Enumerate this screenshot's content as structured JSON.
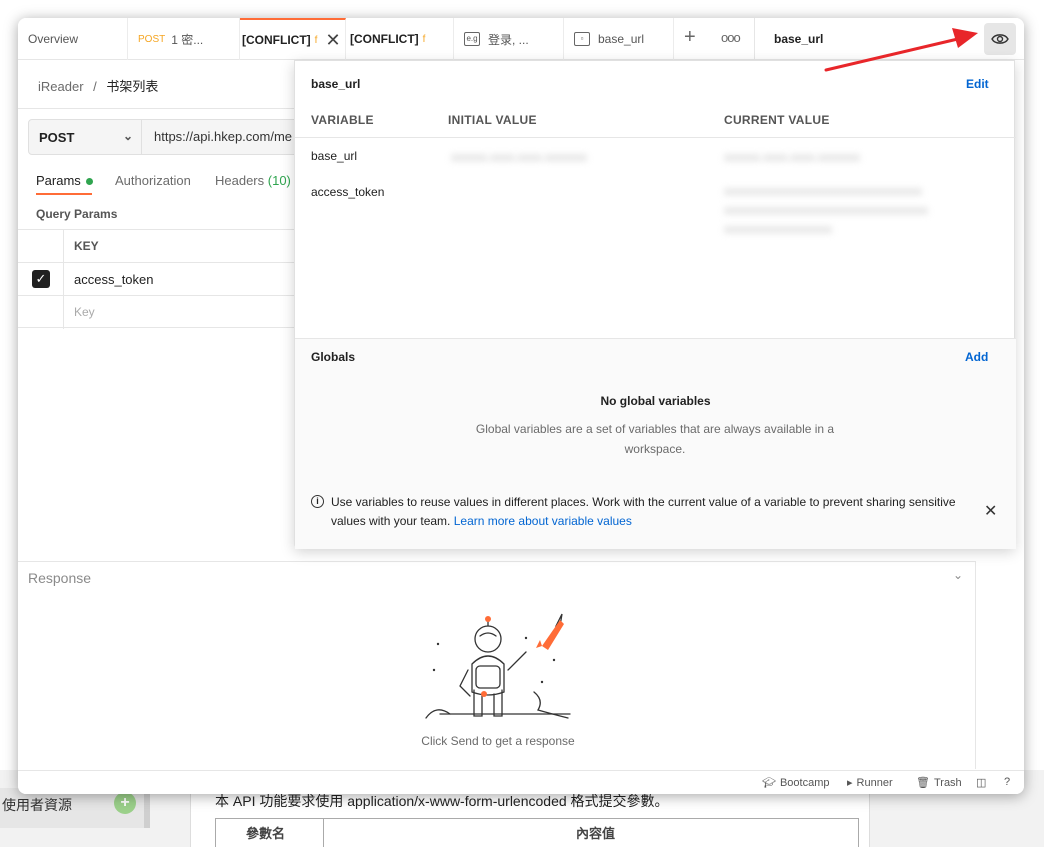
{
  "background": {
    "sidebar_label": "使用者資源",
    "doc_text": "本 API 功能要求使用 application/x-www-form-urlencoded 格式提交參數。",
    "table_col1": "參數名",
    "table_col2": "內容值"
  },
  "tabs": [
    {
      "label": "Overview"
    },
    {
      "method": "POST",
      "label": "1 密..."
    },
    {
      "label": "[CONFLICT]",
      "suffix": "f"
    },
    {
      "label": "[CONFLICT]",
      "suffix": "f"
    },
    {
      "label": "登录, ..."
    },
    {
      "label": "base_url"
    }
  ],
  "environment": {
    "selected": "base_url"
  },
  "request": {
    "breadcrumb_collection": "iReader",
    "breadcrumb_sep": "/",
    "breadcrumb_request": "书架列表",
    "method": "POST",
    "url": "https://api.hkep.com/me",
    "tabs": {
      "params": "Params",
      "authorization": "Authorization",
      "headers": "Headers",
      "headers_count": "(10)"
    },
    "query_params_title": "Query Params",
    "table_head_key": "KEY",
    "params": [
      {
        "key": "access_token"
      }
    ],
    "key_placeholder": "Key"
  },
  "response": {
    "title": "Response",
    "hint": "Click Send to get a response"
  },
  "statusbar": {
    "bootcamp": "Bootcamp",
    "runner": "Runner",
    "trash": "Trash"
  },
  "variables_popover": {
    "env_name": "base_url",
    "edit_label": "Edit",
    "headers": {
      "variable": "VARIABLE",
      "initial": "INITIAL VALUE",
      "current": "CURRENT VALUE"
    },
    "rows": [
      {
        "name": "base_url"
      },
      {
        "name": "access_token"
      }
    ],
    "globals_title": "Globals",
    "add_label": "Add",
    "empty_title": "No global variables",
    "empty_desc": "Global variables are a set of variables that are always available in a workspace.",
    "info_text": "Use variables to reuse values in different places. Work with the current value of a variable to prevent sharing sensitive values with your team.",
    "info_link": "Learn more about variable values"
  },
  "colors": {
    "accent": "#ff6c37",
    "link": "#0265d2",
    "success": "#2fa44f",
    "arrow": "#e8262a"
  }
}
